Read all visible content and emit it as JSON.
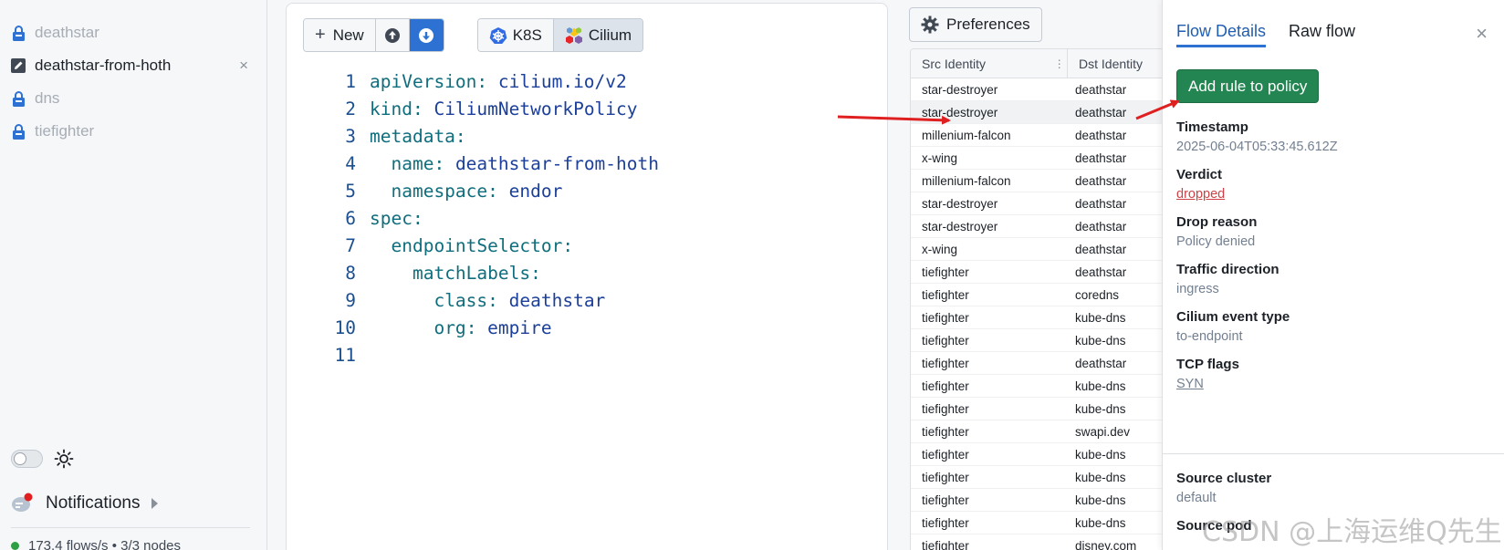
{
  "sidebar": {
    "policies": [
      {
        "name": "deathstar",
        "icon": "lock-icon"
      },
      {
        "name": "deathstar-from-hoth",
        "icon": "edit-icon",
        "active": true
      },
      {
        "name": "dns",
        "icon": "lock-icon"
      },
      {
        "name": "tiefighter",
        "icon": "lock-icon"
      }
    ],
    "close_glyph": "×",
    "notifications_label": "Notifications",
    "status_text": "173.4 flows/s  •  3/3 nodes"
  },
  "toolbar": {
    "new_label": "New",
    "new_glyph": "+",
    "k8s_label": "K8S",
    "cilium_label": "Cilium"
  },
  "editor": {
    "lines": [
      {
        "n": "1",
        "indent": "",
        "key": "apiVersion",
        "val": "cilium.io/v2"
      },
      {
        "n": "2",
        "indent": "",
        "key": "kind",
        "val": "CiliumNetworkPolicy"
      },
      {
        "n": "3",
        "indent": "",
        "key": "metadata",
        "val": ""
      },
      {
        "n": "4",
        "indent": "  ",
        "key": "name",
        "val": "deathstar-from-hoth"
      },
      {
        "n": "5",
        "indent": "  ",
        "key": "namespace",
        "val": "endor"
      },
      {
        "n": "6",
        "indent": "",
        "key": "spec",
        "val": ""
      },
      {
        "n": "7",
        "indent": "  ",
        "key": "endpointSelector",
        "val": ""
      },
      {
        "n": "8",
        "indent": "    ",
        "key": "matchLabels",
        "val": ""
      },
      {
        "n": "9",
        "indent": "      ",
        "key": "class",
        "val": "deathstar"
      },
      {
        "n": "10",
        "indent": "      ",
        "key": "org",
        "val": "empire"
      },
      {
        "n": "11",
        "indent": "",
        "key": "",
        "val": ""
      }
    ]
  },
  "flows": {
    "preferences_label": "Preferences",
    "headers": {
      "src": "Src Identity",
      "dst": "Dst Identity"
    },
    "rows": [
      [
        "star-destroyer",
        "deathstar"
      ],
      [
        "star-destroyer",
        "deathstar"
      ],
      [
        "millenium-falcon",
        "deathstar"
      ],
      [
        "x-wing",
        "deathstar"
      ],
      [
        "millenium-falcon",
        "deathstar"
      ],
      [
        "star-destroyer",
        "deathstar"
      ],
      [
        "star-destroyer",
        "deathstar"
      ],
      [
        "x-wing",
        "deathstar"
      ],
      [
        "tiefighter",
        "deathstar"
      ],
      [
        "tiefighter",
        "coredns"
      ],
      [
        "tiefighter",
        "kube-dns"
      ],
      [
        "tiefighter",
        "kube-dns"
      ],
      [
        "tiefighter",
        "deathstar"
      ],
      [
        "tiefighter",
        "kube-dns"
      ],
      [
        "tiefighter",
        "kube-dns"
      ],
      [
        "tiefighter",
        "swapi.dev"
      ],
      [
        "tiefighter",
        "kube-dns"
      ],
      [
        "tiefighter",
        "kube-dns"
      ],
      [
        "tiefighter",
        "kube-dns"
      ],
      [
        "tiefighter",
        "kube-dns"
      ],
      [
        "tiefighter",
        "disney.com"
      ]
    ],
    "highlighted_row": 1
  },
  "details": {
    "tab_flow": "Flow Details",
    "tab_raw": "Raw flow",
    "close_glyph": "×",
    "add_rule_label": "Add rule to policy",
    "fields": [
      {
        "label": "Timestamp",
        "value": "2025-06-04T05:33:45.612Z",
        "style": ""
      },
      {
        "label": "Verdict",
        "value": "dropped",
        "style": "link-red"
      },
      {
        "label": "Drop reason",
        "value": "Policy denied",
        "style": ""
      },
      {
        "label": "Traffic direction",
        "value": "ingress",
        "style": ""
      },
      {
        "label": "Cilium event type",
        "value": "to-endpoint",
        "style": ""
      },
      {
        "label": "TCP flags",
        "value": "SYN",
        "style": "link-grey"
      }
    ],
    "fields2": [
      {
        "label": "Source cluster",
        "value": "default",
        "style": ""
      },
      {
        "label": "Source pod",
        "value": "",
        "style": ""
      }
    ]
  },
  "watermark": "CSDN @上海运维Q先生",
  "colors": {
    "accent": "#2d72d2",
    "success": "#238551",
    "danger": "#cd4246",
    "arrow": "#e02020"
  }
}
